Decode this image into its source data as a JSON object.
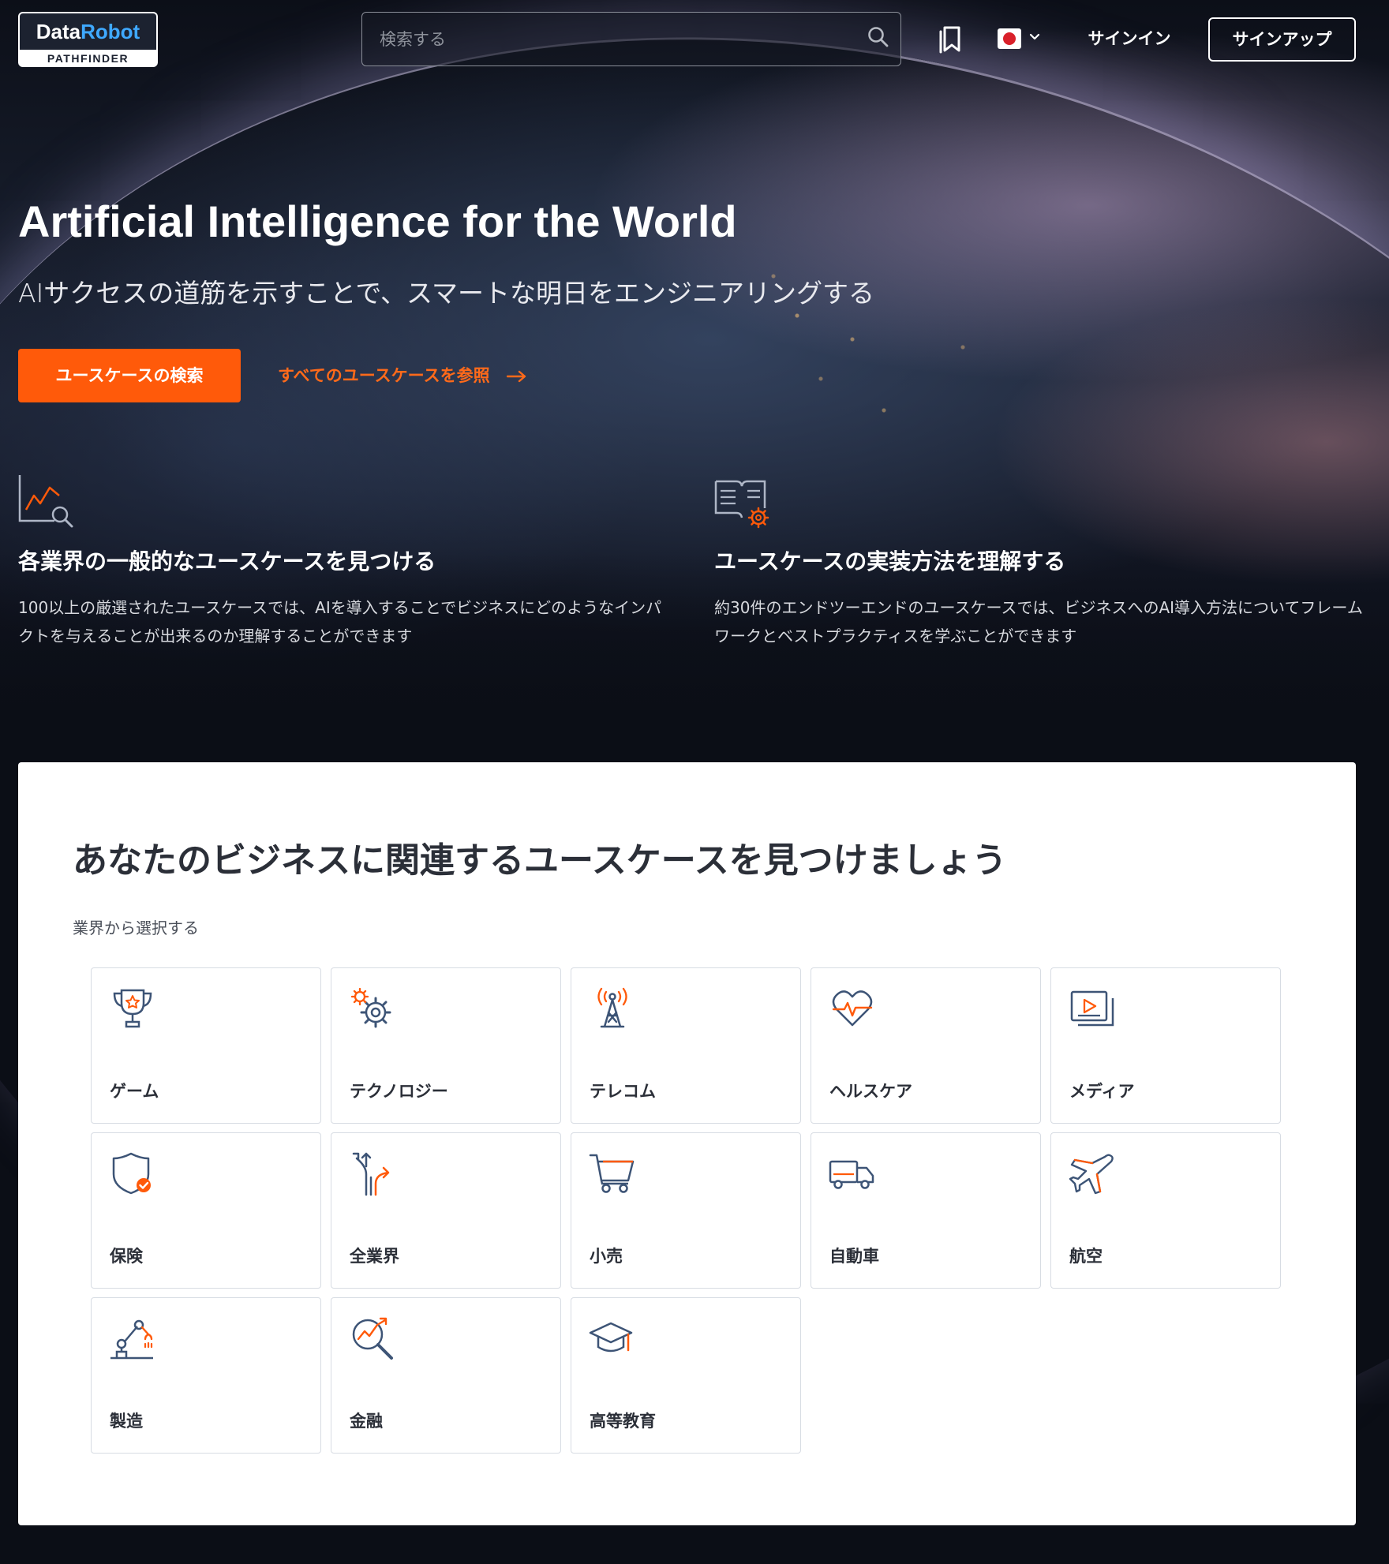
{
  "nav": {
    "logo_top_a": "Data",
    "logo_top_b": "Robot",
    "logo_bottom": "PATHFINDER",
    "search_placeholder": "検索する",
    "signin_label": "サインイン",
    "signup_label": "サインアップ",
    "language_flag": "japan-flag"
  },
  "hero": {
    "title": "Artificial Intelligence for the World",
    "subtitle": "AIサクセスの道筋を示すことで、スマートな明日をエンジニアリングする",
    "primary_button": "ユースケースの検索",
    "link_label": "すべてのユースケースを参照"
  },
  "features": [
    {
      "icon": "chart-search-icon",
      "title": "各業界の一般的なユースケースを見つける",
      "description": "100以上の厳選されたユースケースでは、AIを導入することでビジネスにどのようなインパクトを与えることが出来るのか理解することができます"
    },
    {
      "icon": "book-gear-icon",
      "title": "ユースケースの実装方法を理解する",
      "description": "約30件のエンドツーエンドのユースケースでは、ビジネスへのAI導入方法についてフレームワークとベストプラクティスを学ぶことができます"
    }
  ],
  "industry_panel": {
    "title": "あなたのビジネスに関連するユースケースを見つけましょう",
    "subtitle": "業界から選択する",
    "industries": [
      {
        "label": "ゲーム",
        "icon": "trophy-icon"
      },
      {
        "label": "テクノロジー",
        "icon": "gears-icon"
      },
      {
        "label": "テレコム",
        "icon": "antenna-tower-icon"
      },
      {
        "label": "ヘルスケア",
        "icon": "heartbeat-icon"
      },
      {
        "label": "メディア",
        "icon": "media-play-icon"
      },
      {
        "label": "保険",
        "icon": "shield-check-icon"
      },
      {
        "label": "全業界",
        "icon": "diverging-arrows-icon"
      },
      {
        "label": "小売",
        "icon": "shopping-cart-icon"
      },
      {
        "label": "自動車",
        "icon": "truck-icon"
      },
      {
        "label": "航空",
        "icon": "airplane-icon"
      },
      {
        "label": "製造",
        "icon": "robot-arm-icon"
      },
      {
        "label": "金融",
        "icon": "magnifier-chart-icon"
      },
      {
        "label": "高等教育",
        "icon": "graduation-cap-icon"
      }
    ]
  },
  "colors": {
    "accent_orange": "#ff5a0a",
    "icon_blue": "#3d5476",
    "background_dark": "#0b0e16",
    "panel_white": "#ffffff"
  }
}
